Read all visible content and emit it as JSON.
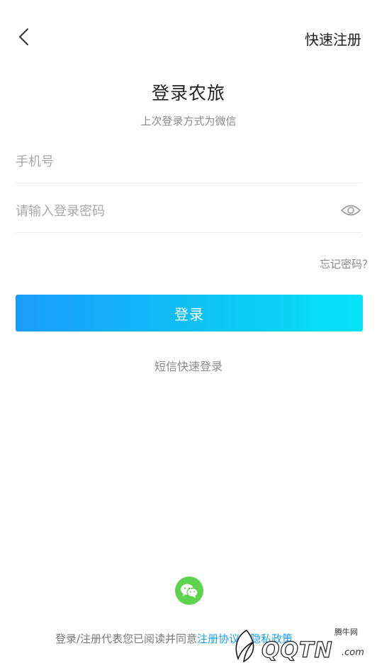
{
  "header": {
    "back_label": "",
    "quick_register": "快速注册"
  },
  "login": {
    "title": "登录农旅",
    "last_method": "上次登录方式为微信",
    "phone_placeholder": "手机号",
    "password_placeholder": "请输入登录密码",
    "forgot": "忘记密码？",
    "submit": "登录",
    "sms_login": "短信快速登录"
  },
  "footer": {
    "agreement_prefix": "登录/注册代表您已阅读并同意",
    "agreement_link": "注册协议及隐私政策"
  },
  "watermark": {
    "brand": "QQTN",
    "suffix": ".com",
    "site_name": "腾牛网"
  },
  "colors": {
    "accent": "#1aa0f5",
    "button_start": "#1a9bfb",
    "button_end": "#05e4f7",
    "wechat": "#5ed34e"
  },
  "icons": {
    "back": "chevron-left-icon",
    "eye": "eye-icon",
    "wechat": "wechat-icon"
  }
}
